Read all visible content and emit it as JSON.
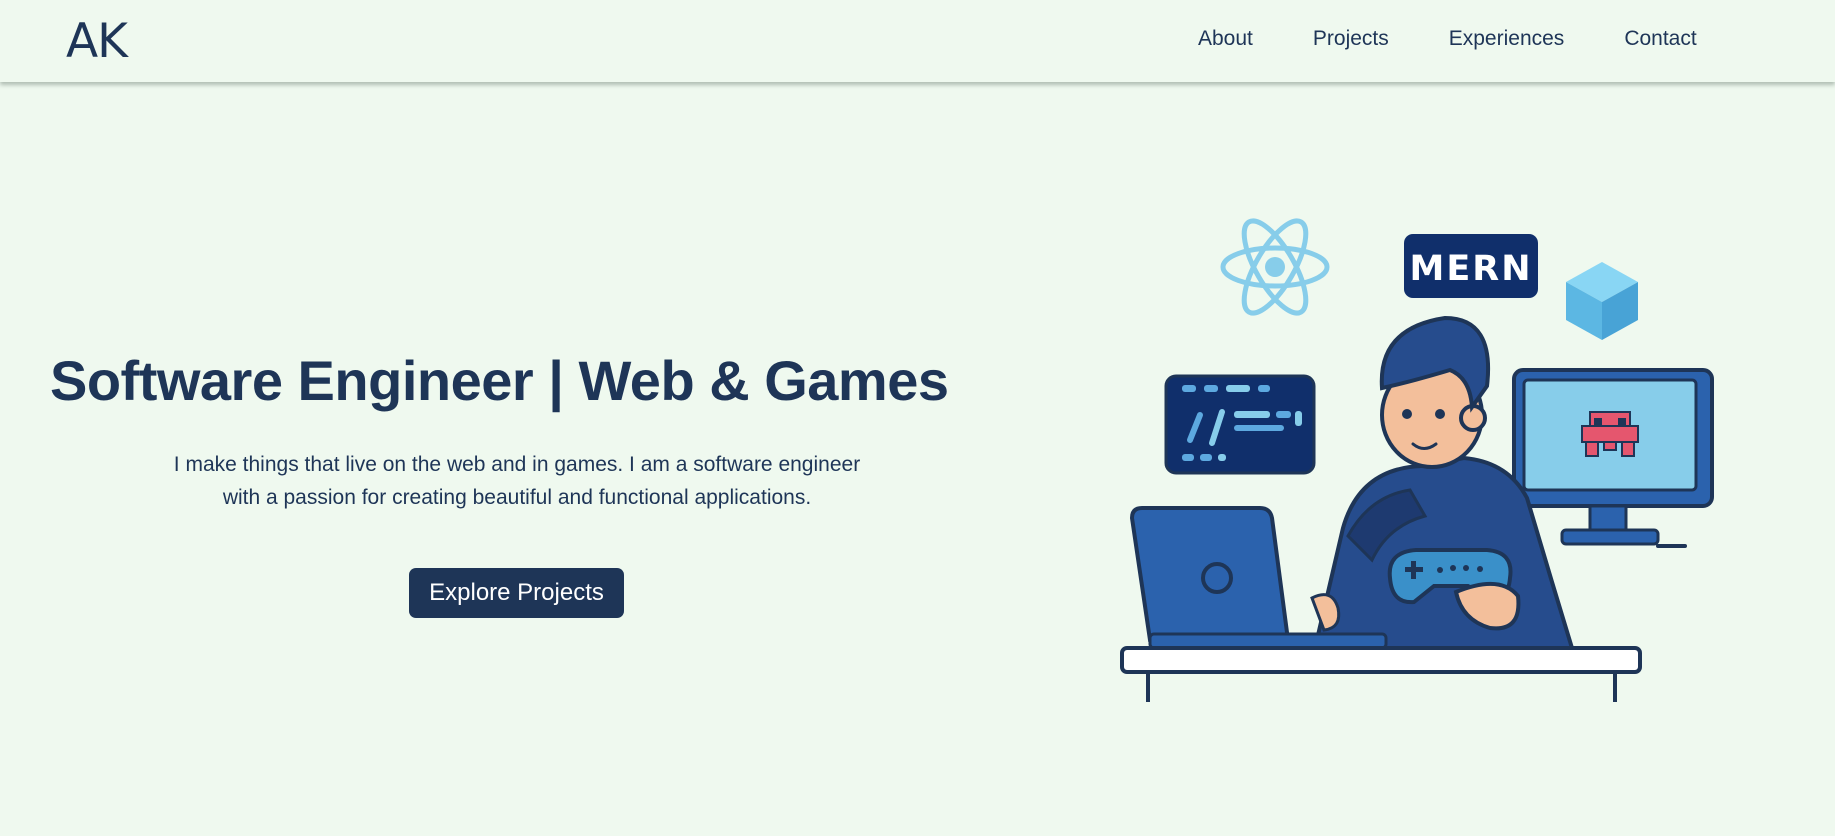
{
  "header": {
    "logo": "AK",
    "nav": [
      "About",
      "Projects",
      "Experiences",
      "Contact"
    ]
  },
  "hero": {
    "title": "Software Engineer | Web & Games",
    "description": "I make things that live on the web and in games. I am a software engineer with a passion for creating beautiful and functional applications.",
    "cta_label": "Explore Projects"
  },
  "illustration": {
    "badge_text": "MERN",
    "icons": [
      "react-atom-icon",
      "cube-icon",
      "code-panel-icon",
      "laptop-icon",
      "monitor-icon",
      "pixel-invader-icon",
      "gamepad-icon"
    ]
  },
  "colors": {
    "background": "#eff9ef",
    "primary": "#1e3557",
    "navy": "#102f6b",
    "accent_blue": "#2b62ad",
    "light_blue": "#87cdea",
    "skin": "#f3bf9b",
    "pink": "#e5566e"
  }
}
